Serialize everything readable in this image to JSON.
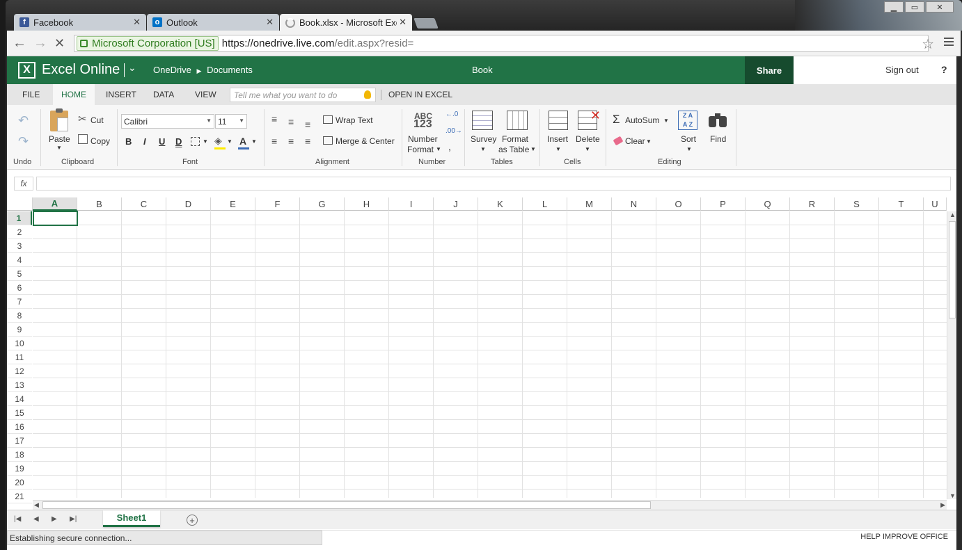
{
  "browser": {
    "tabs": [
      {
        "label": "Facebook",
        "icon": "facebook-icon",
        "color": "#3b5998"
      },
      {
        "label": "Outlook",
        "icon": "outlook-icon",
        "color": "#0072c6"
      },
      {
        "label": "Book.xlsx - Microsoft Exce",
        "icon": "loading-spinner-icon"
      }
    ],
    "ev_cert": "Microsoft Corporation [US]",
    "url_host": "https://onedrive.live.com",
    "url_path": "/edit.aspx?resid="
  },
  "app": {
    "title": "Excel Online",
    "breadcrumb": [
      "OneDrive",
      "Documents"
    ],
    "document_title": "Book",
    "share_label": "Share",
    "signout_label": "Sign out",
    "help_label": "?",
    "brand_color": "#217346"
  },
  "ribbon_tabs": [
    "FILE",
    "HOME",
    "INSERT",
    "DATA",
    "VIEW"
  ],
  "selected_tab": "HOME",
  "tell_me_placeholder": "Tell me what you want to do",
  "open_in_excel": "OPEN IN EXCEL",
  "ribbon": {
    "undo": {
      "group": "Undo"
    },
    "clipboard": {
      "group": "Clipboard",
      "paste": "Paste",
      "cut": "Cut",
      "copy": "Copy"
    },
    "font": {
      "group": "Font",
      "family": "Calibri",
      "size": "11",
      "bold": "B",
      "italic": "I",
      "underline": "U",
      "double_underline": "D",
      "color_letter": "A"
    },
    "alignment": {
      "group": "Alignment",
      "wrap": "Wrap Text",
      "merge": "Merge & Center"
    },
    "number": {
      "group": "Number",
      "format_line1": "Number",
      "format_line2": "Format",
      "abc": "ABC",
      "n123": "123"
    },
    "tables": {
      "group": "Tables",
      "survey": "Survey",
      "format_line1": "Format",
      "format_line2": "as Table"
    },
    "cells": {
      "group": "Cells",
      "insert": "Insert",
      "delete": "Delete"
    },
    "editing": {
      "group": "Editing",
      "autosum": "AutoSum",
      "clear": "Clear",
      "sort": "Sort",
      "find": "Find"
    }
  },
  "formula_bar": {
    "label": "fx",
    "value": ""
  },
  "columns": [
    "A",
    "B",
    "C",
    "D",
    "E",
    "F",
    "G",
    "H",
    "I",
    "J",
    "K",
    "L",
    "M",
    "N",
    "O",
    "P",
    "Q",
    "R",
    "S",
    "T",
    "U"
  ],
  "rows": [
    "1",
    "2",
    "3",
    "4",
    "5",
    "6",
    "7",
    "8",
    "9",
    "10",
    "11",
    "12",
    "13",
    "14",
    "15",
    "16",
    "17",
    "18",
    "19",
    "20",
    "21"
  ],
  "active_cell": "A1",
  "sheets": [
    "Sheet1"
  ],
  "status": {
    "left": "Establishing secure connection...",
    "right": "HELP IMPROVE OFFICE"
  }
}
